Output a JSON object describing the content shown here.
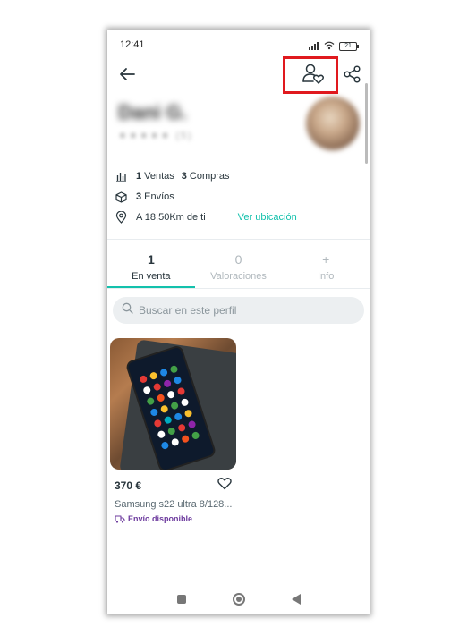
{
  "status_bar": {
    "time": "12:41",
    "battery": "21"
  },
  "profile": {
    "name": "Dani G.",
    "rating_stars": "★★★★★ (5)"
  },
  "stats": {
    "ventas_count": "1",
    "ventas_label": "Ventas",
    "compras_count": "3",
    "compras_label": "Compras",
    "envios_count": "3",
    "envios_label": "Envíos",
    "distance": "A 18,50Km de ti",
    "location_link": "Ver ubicación"
  },
  "tabs": [
    {
      "count": "1",
      "label": "En venta",
      "active": true
    },
    {
      "count": "0",
      "label": "Valoraciones",
      "active": false
    },
    {
      "count": "+",
      "label": "Info",
      "active": false
    }
  ],
  "search": {
    "placeholder": "Buscar en este perfil"
  },
  "listing": {
    "price": "370 €",
    "title": "Samsung  s22 ultra 8/128...",
    "shipping": "Envío disponible"
  },
  "colors": {
    "accent": "#13c1ac",
    "highlight": "#e0191e",
    "shipping": "#6d3b9e"
  },
  "icons": {
    "back": "arrow-left-icon",
    "favorite_user": "user-heart-icon",
    "share": "share-icon",
    "sales": "bar-chart-icon",
    "shipments": "box-icon",
    "location": "location-pin-icon",
    "search": "search-icon",
    "like": "heart-icon",
    "truck": "truck-icon"
  }
}
